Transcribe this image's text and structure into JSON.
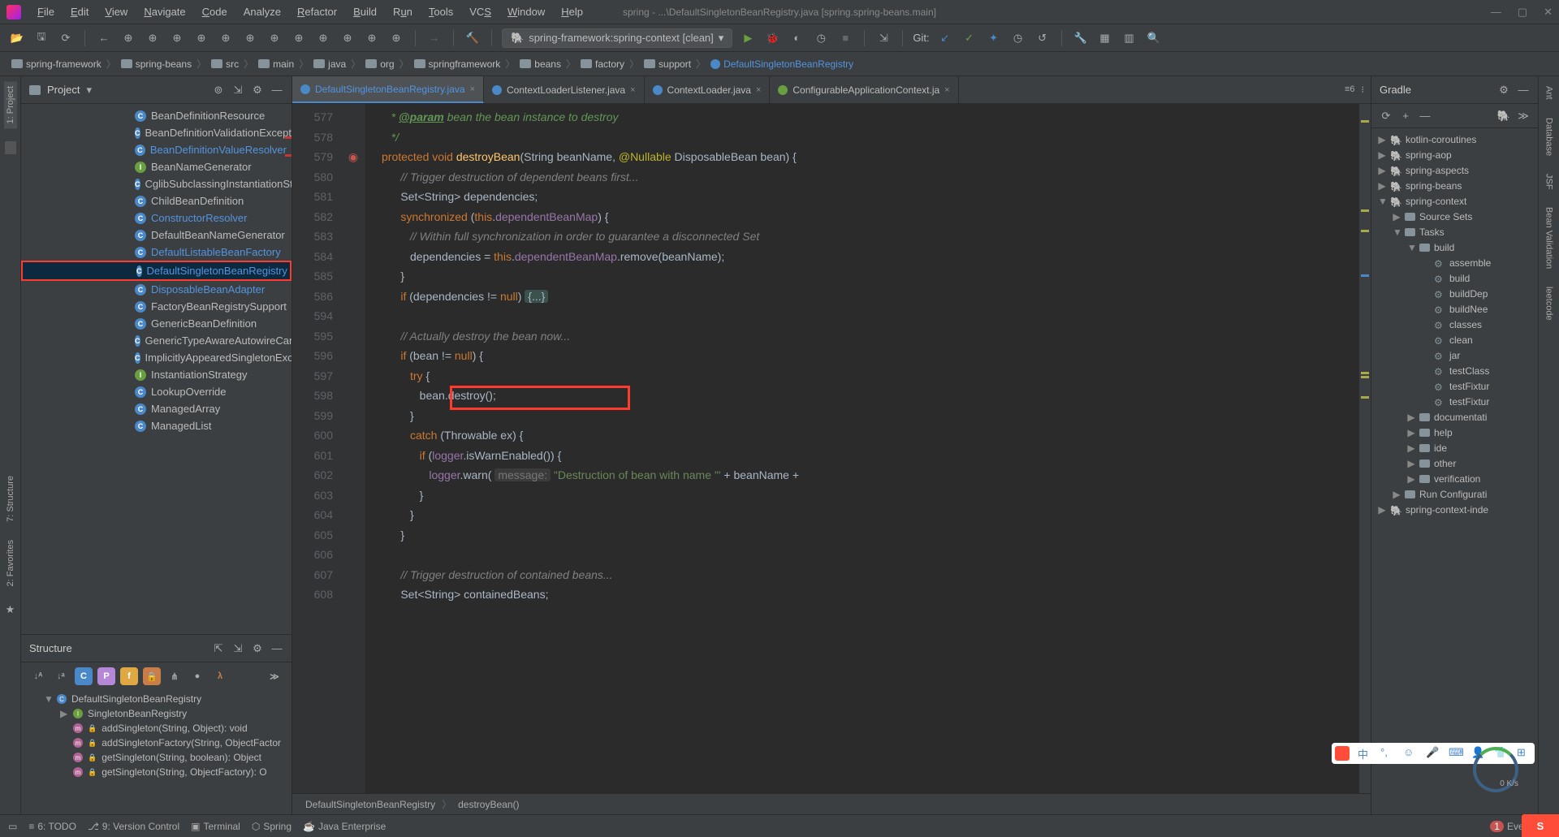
{
  "menu": {
    "file": "File",
    "edit": "Edit",
    "view": "View",
    "navigate": "Navigate",
    "code": "Code",
    "analyze": "Analyze",
    "refactor": "Refactor",
    "build": "Build",
    "run": "Run",
    "tools": "Tools",
    "vcs": "VCS",
    "window": "Window",
    "help": "Help"
  },
  "window_title": "spring - ...\\DefaultSingletonBeanRegistry.java [spring.spring-beans.main]",
  "run_config": "spring-framework:spring-context [clean]",
  "git_label": "Git:",
  "crumbs": [
    "spring-framework",
    "spring-beans",
    "src",
    "main",
    "java",
    "org",
    "springframework",
    "beans",
    "factory",
    "support",
    "DefaultSingletonBeanRegistry"
  ],
  "project_label": "Project",
  "project_tree": [
    {
      "icon": "c",
      "label": "BeanDefinitionResource"
    },
    {
      "icon": "c",
      "label": "BeanDefinitionValidationExceptio"
    },
    {
      "icon": "c",
      "label": "BeanDefinitionValueResolver",
      "link": true
    },
    {
      "icon": "i",
      "label": "BeanNameGenerator"
    },
    {
      "icon": "c",
      "label": "CglibSubclassingInstantiationStrat"
    },
    {
      "icon": "c",
      "label": "ChildBeanDefinition"
    },
    {
      "icon": "c",
      "label": "ConstructorResolver",
      "link": true
    },
    {
      "icon": "c",
      "label": "DefaultBeanNameGenerator"
    },
    {
      "icon": "c",
      "label": "DefaultListableBeanFactory",
      "link": true
    },
    {
      "icon": "c",
      "label": "DefaultSingletonBeanRegistry",
      "link": true,
      "sel": true,
      "boxed": true
    },
    {
      "icon": "c",
      "label": "DisposableBeanAdapter",
      "link": true
    },
    {
      "icon": "c",
      "label": "FactoryBeanRegistrySupport"
    },
    {
      "icon": "c",
      "label": "GenericBeanDefinition"
    },
    {
      "icon": "c",
      "label": "GenericTypeAwareAutowireCandi"
    },
    {
      "icon": "c",
      "label": "ImplicitlyAppearedSingletonExcep"
    },
    {
      "icon": "i",
      "label": "InstantiationStrategy"
    },
    {
      "icon": "c",
      "label": "LookupOverride"
    },
    {
      "icon": "c",
      "label": "ManagedArray"
    },
    {
      "icon": "c",
      "label": "ManagedList"
    }
  ],
  "structure_label": "Structure",
  "structure_tree": [
    {
      "depth": 0,
      "icon": "cl",
      "tri": "▼",
      "label": "DefaultSingletonBeanRegistry"
    },
    {
      "depth": 1,
      "icon": "in",
      "tri": "▶",
      "label": "SingletonBeanRegistry"
    },
    {
      "depth": 1,
      "icon": "m",
      "tri": "",
      "label": "addSingleton(String, Object): void",
      "lock": true
    },
    {
      "depth": 1,
      "icon": "m",
      "tri": "",
      "label": "addSingletonFactory(String, ObjectFactor",
      "lock": true
    },
    {
      "depth": 1,
      "icon": "m",
      "tri": "",
      "label": "getSingleton(String, boolean): Object",
      "lock": true
    },
    {
      "depth": 1,
      "icon": "m",
      "tri": "",
      "label": "getSingleton(String, ObjectFactory<?>): O",
      "lock": true
    }
  ],
  "tabs": [
    {
      "label": "DefaultSingletonBeanRegistry.java",
      "active": true,
      "icon": "j"
    },
    {
      "label": "ContextLoaderListener.java",
      "icon": "j"
    },
    {
      "label": "ContextLoader.java",
      "icon": "j"
    },
    {
      "label": "ConfigurableApplicationContext.ja",
      "icon": "s"
    }
  ],
  "tab_overflow": "≡6",
  "line_numbers": [
    "577",
    "578",
    "579",
    "580",
    "581",
    "582",
    "583",
    "584",
    "585",
    "586",
    "594",
    "595",
    "596",
    "597",
    "598",
    "599",
    "600",
    "601",
    "602",
    "603",
    "604",
    "605",
    "606",
    "607",
    "608"
  ],
  "code_lines": [
    {
      "t": "doc",
      "raw": "   * @param bean the bean instance to destroy"
    },
    {
      "t": "doc",
      "raw": "   */"
    },
    {
      "t": "sig"
    },
    {
      "t": "cmt",
      "raw": "      // Trigger destruction of dependent beans first..."
    },
    {
      "t": "l581"
    },
    {
      "t": "l582"
    },
    {
      "t": "cmt",
      "raw": "         // Within full synchronization in order to guarantee a disconnected Set"
    },
    {
      "t": "l584"
    },
    {
      "t": "plain",
      "raw": "      }"
    },
    {
      "t": "l586"
    },
    {
      "t": "blank"
    },
    {
      "t": "cmt",
      "raw": "      // Actually destroy the bean now..."
    },
    {
      "t": "l596"
    },
    {
      "t": "l597"
    },
    {
      "t": "l598"
    },
    {
      "t": "plain",
      "raw": "         }"
    },
    {
      "t": "l600"
    },
    {
      "t": "l601"
    },
    {
      "t": "l602"
    },
    {
      "t": "plain",
      "raw": "            }"
    },
    {
      "t": "plain",
      "raw": "         }"
    },
    {
      "t": "plain",
      "raw": "      }"
    },
    {
      "t": "blank"
    },
    {
      "t": "cmt",
      "raw": "      // Trigger destruction of contained beans..."
    },
    {
      "t": "l608"
    }
  ],
  "breadcrumb2": [
    "DefaultSingletonBeanRegistry",
    "destroyBean()"
  ],
  "gradle_label": "Gradle",
  "gradle_tree": [
    {
      "d": 0,
      "tri": "▶",
      "i": "ele",
      "label": "kotlin-coroutines"
    },
    {
      "d": 0,
      "tri": "▶",
      "i": "ele",
      "label": "spring-aop"
    },
    {
      "d": 0,
      "tri": "▶",
      "i": "ele",
      "label": "spring-aspects"
    },
    {
      "d": 0,
      "tri": "▶",
      "i": "ele",
      "label": "spring-beans"
    },
    {
      "d": 0,
      "tri": "▼",
      "i": "ele",
      "label": "spring-context"
    },
    {
      "d": 1,
      "tri": "▶",
      "i": "fld",
      "label": "Source Sets"
    },
    {
      "d": 1,
      "tri": "▼",
      "i": "fld",
      "label": "Tasks"
    },
    {
      "d": 2,
      "tri": "▼",
      "i": "fld",
      "label": "build"
    },
    {
      "d": 3,
      "tri": "",
      "i": "gear",
      "label": "assemble"
    },
    {
      "d": 3,
      "tri": "",
      "i": "gear",
      "label": "build"
    },
    {
      "d": 3,
      "tri": "",
      "i": "gear",
      "label": "buildDep"
    },
    {
      "d": 3,
      "tri": "",
      "i": "gear",
      "label": "buildNee"
    },
    {
      "d": 3,
      "tri": "",
      "i": "gear",
      "label": "classes"
    },
    {
      "d": 3,
      "tri": "",
      "i": "gear",
      "label": "clean"
    },
    {
      "d": 3,
      "tri": "",
      "i": "gear",
      "label": "jar"
    },
    {
      "d": 3,
      "tri": "",
      "i": "gear",
      "label": "testClass"
    },
    {
      "d": 3,
      "tri": "",
      "i": "gear",
      "label": "testFixtur"
    },
    {
      "d": 3,
      "tri": "",
      "i": "gear",
      "label": "testFixtur"
    },
    {
      "d": 2,
      "tri": "▶",
      "i": "fld",
      "label": "documentati"
    },
    {
      "d": 2,
      "tri": "▶",
      "i": "fld",
      "label": "help"
    },
    {
      "d": 2,
      "tri": "▶",
      "i": "fld",
      "label": "ide"
    },
    {
      "d": 2,
      "tri": "▶",
      "i": "fld",
      "label": "other"
    },
    {
      "d": 2,
      "tri": "▶",
      "i": "fld",
      "label": "verification"
    },
    {
      "d": 1,
      "tri": "▶",
      "i": "fld",
      "label": "Run Configurati"
    },
    {
      "d": 0,
      "tri": "▶",
      "i": "ele",
      "label": "spring-context-inde"
    }
  ],
  "right_tabs": [
    "Ant",
    "Database",
    "JSF",
    "Bean Validation",
    "leetcode"
  ],
  "status": {
    "todo": "6: TODO",
    "vcs": "9: Version Control",
    "terminal": "Terminal",
    "spring": "Spring",
    "jee": "Java Enterprise",
    "eventlog": "Event Log",
    "events": "1",
    "speed": "0 K/s"
  },
  "left_tabs": {
    "project": "1: Project",
    "structure": "7: Structure",
    "favorites": "2: Favorites"
  }
}
